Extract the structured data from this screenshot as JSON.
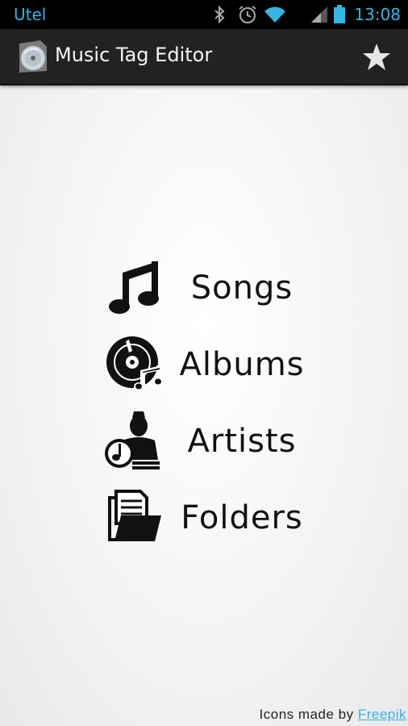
{
  "status_bar": {
    "carrier": "Utel",
    "time": "13:08",
    "accent_color": "#33b5e5",
    "icons": [
      "bluetooth-icon",
      "alarm-icon",
      "wifi-icon",
      "signal-icon",
      "battery-icon"
    ]
  },
  "action_bar": {
    "title": "Music Tag Editor",
    "app_icon": "cd-icon",
    "favorite_icon": "star-icon"
  },
  "menu": {
    "items": [
      {
        "label": "Songs",
        "icon": "music-note-icon"
      },
      {
        "label": "Albums",
        "icon": "album-icon"
      },
      {
        "label": "Artists",
        "icon": "artist-icon"
      },
      {
        "label": "Folders",
        "icon": "folder-icon"
      }
    ]
  },
  "credit": {
    "prefix": "Icons made by",
    "link_text": "Freepik",
    "link_color": "#33b5e5"
  }
}
